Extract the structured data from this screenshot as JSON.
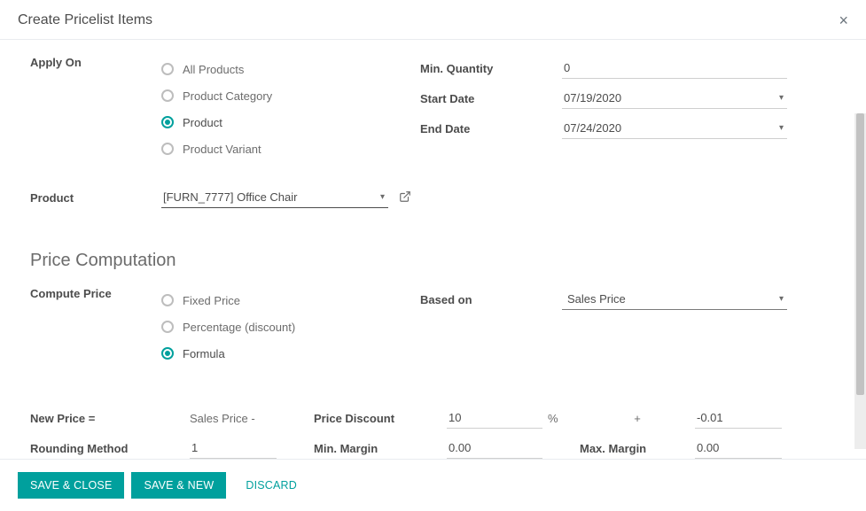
{
  "modal": {
    "title": "Create Pricelist Items"
  },
  "applyOn": {
    "label": "Apply On",
    "options": {
      "all": "All Products",
      "category": "Product Category",
      "product": "Product",
      "variant": "Product Variant"
    }
  },
  "minQty": {
    "label": "Min. Quantity",
    "value": "0"
  },
  "startDate": {
    "label": "Start Date",
    "value": "07/19/2020"
  },
  "endDate": {
    "label": "End Date",
    "value": "07/24/2020"
  },
  "product": {
    "label": "Product",
    "value": "[FURN_7777] Office Chair"
  },
  "section": {
    "priceComputation": "Price Computation"
  },
  "computePrice": {
    "label": "Compute Price",
    "options": {
      "fixed": "Fixed Price",
      "percentage": "Percentage (discount)",
      "formula": "Formula"
    }
  },
  "basedOn": {
    "label": "Based on",
    "value": "Sales Price"
  },
  "newPrice": {
    "label": "New Price =",
    "baseText": "Sales Price -",
    "discountLabel": "Price Discount",
    "discountValue": "10",
    "percentSymbol": "%",
    "plusSymbol": "+",
    "extraValue": "-0.01",
    "roundingLabel": "Rounding Method",
    "roundingValue": "1",
    "minMarginLabel": "Min. Margin",
    "minMarginValue": "0.00",
    "maxMarginLabel": "Max. Margin",
    "maxMarginValue": "0.00"
  },
  "footer": {
    "saveClose": "SAVE & CLOSE",
    "saveNew": "SAVE & NEW",
    "discard": "DISCARD"
  }
}
